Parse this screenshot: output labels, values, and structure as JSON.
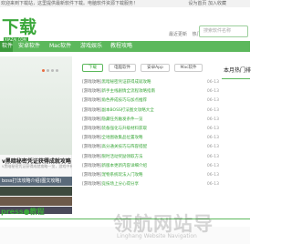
{
  "topbar": {
    "text": "欢迎来到下载站，这里提供最新软件下载。电脑软件资源下载服务！",
    "right": "设为首页  加入收藏"
  },
  "header": {
    "logo": "下载",
    "logo_sub": "XIAZAI.COM",
    "links": [
      "最近更新",
      "热门排行"
    ],
    "search_placeholder": "搜索软件名称"
  },
  "nav": {
    "items": [
      "软件",
      "安卓软件",
      "Mac软件",
      "游戏娱乐",
      "教程攻略"
    ],
    "active_index": 0
  },
  "banner": {
    "title": "v黑暗秘密凭证获得成就攻略",
    "desc": "v黑暗秘密凭证获得成就攻略一览，游戏中有不少成就",
    "thumbs": [
      "boss打法攻略介绍(图文攻略)",
      "",
      "",
      ""
    ]
  },
  "tabs": [
    "下载",
    "电脑软件",
    "安卓App",
    "Mac软件"
  ],
  "list": [
    {
      "cat": "[游戏攻略]",
      "title": "黑暗秘密凭证获得成就攻略",
      "date": "06-13"
    },
    {
      "cat": "[游戏攻略]",
      "title": "新手主线剧情全流程攻略指南",
      "date": "06-13"
    },
    {
      "cat": "[游戏攻略]",
      "title": "角色养成技巧与加点推荐",
      "date": "06-13"
    },
    {
      "cat": "[游戏攻略]",
      "title": "副本BOSS打法图文攻略大全",
      "date": "06-13"
    },
    {
      "cat": "[游戏攻略]",
      "title": "隐藏任务触发条件一览",
      "date": "06-13"
    },
    {
      "cat": "[游戏攻略]",
      "title": "装备强化与升级材料获取",
      "date": "06-13"
    },
    {
      "cat": "[游戏攻略]",
      "title": "全地图收集品位置攻略",
      "date": "06-13"
    },
    {
      "cat": "[游戏攻略]",
      "title": "高分通关技巧与阵容搭配",
      "date": "06-13"
    },
    {
      "cat": "[游戏攻略]",
      "title": "限时活动奖励领取方法",
      "date": "06-13"
    },
    {
      "cat": "[游戏攻略]",
      "title": "新版本更新内容详细介绍",
      "date": "06-13"
    },
    {
      "cat": "[游戏攻略]",
      "title": "宠物系统玩法入门攻略",
      "date": "06-13"
    },
    {
      "cat": "[游戏攻略]",
      "title": "竞技场上分心得分享",
      "date": "06-13"
    }
  ],
  "rightbar": {
    "title": "本月热门排"
  },
  "section": {
    "title": "press●教程"
  },
  "watermark": {
    "main": "领航网站导",
    "sub": "Linghang Website Navigation"
  }
}
